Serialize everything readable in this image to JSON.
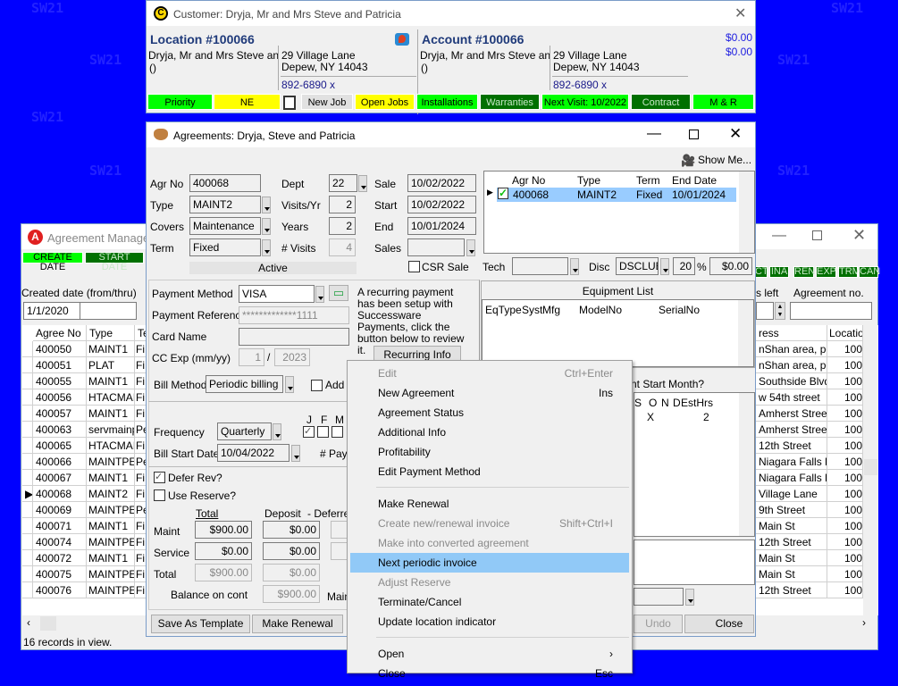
{
  "watermark": "SW21",
  "customer": {
    "title": "Customer: Dryja, Mr and Mrs Steve and Patricia",
    "location": {
      "heading": "Location #100066",
      "name": "Dryja, Mr and Mrs Steve and F",
      "phone_paren": "()",
      "addr1": "29 Village Lane",
      "addr2": "Depew, NY  14043",
      "phone": "892-6890 x"
    },
    "account": {
      "heading": "Account #100066",
      "name": "Dryja, Mr and Mrs Steve and F",
      "phone_paren": "()",
      "addr1": "29 Village Lane",
      "addr2": "Depew, NY  14043",
      "phone": "892-6890 x",
      "balance1": "$0.00",
      "balance2": "$0.00"
    },
    "buttons": [
      "Priority",
      "NE",
      "New Job",
      "Open Jobs",
      "Installations",
      "Warranties",
      "Next Visit: 10/2022",
      "Contract",
      "M & R"
    ]
  },
  "manager": {
    "title": "Agreement Manager",
    "filters_left": [
      "CREATE DATE",
      "START DATE"
    ],
    "filters_right": [
      "CT",
      "INA",
      "REN",
      "EXP",
      "TRM",
      "CAN"
    ],
    "created_label": "Created date (from/thru)",
    "created_from": "1/1/2020",
    "created_thru": "",
    "visits_left_label": "s left",
    "agreement_no_label": "Agreement no.",
    "agreement_no": "",
    "columns": [
      "Agree No",
      "Type",
      "Te"
    ],
    "right_columns": [
      "ress",
      "Location"
    ],
    "rows": [
      [
        "400050",
        "MAINT1",
        "Fi",
        "nShan area, poly",
        "100"
      ],
      [
        "400051",
        "PLAT",
        "Fi",
        "nShan area, poly",
        "100"
      ],
      [
        "400055",
        "MAINT1",
        "Fi",
        "Southside Blvd.",
        "100"
      ],
      [
        "400056",
        "HTACMAIN",
        "Fi",
        "w 54th street",
        "100"
      ],
      [
        "400057",
        "MAINT1",
        "Fi",
        "Amherst Street",
        "100"
      ],
      [
        "400063",
        "servmainpe",
        "Pe",
        "Amherst Street",
        "100"
      ],
      [
        "400065",
        "HTACMAIN",
        "Fi",
        "12th Street",
        "100"
      ],
      [
        "400066",
        "MAINTPER",
        "Pe",
        "Niagara Falls Blv",
        "100"
      ],
      [
        "400067",
        "MAINT1",
        "Fi",
        "Niagara Falls Blv",
        "100"
      ],
      [
        "400068",
        "MAINT2",
        "Fi",
        "Village Lane",
        "100"
      ],
      [
        "400069",
        "MAINTPER",
        "Pe",
        "9th Street",
        "100"
      ],
      [
        "400071",
        "MAINT1",
        "Fi",
        "Main St",
        "100"
      ],
      [
        "400074",
        "MAINTPER",
        "Fi",
        "12th Street",
        "100"
      ],
      [
        "400072",
        "MAINT1",
        "Fi",
        "Main St",
        "100"
      ],
      [
        "400075",
        "MAINTPER",
        "Fi",
        "Main St",
        "100"
      ],
      [
        "400076",
        "MAINTPER",
        "Fi",
        "12th Street",
        "100"
      ]
    ],
    "selected_row": "400068",
    "status": "16 records in view."
  },
  "agreement": {
    "title": "Agreements: Dryja, Steve and Patricia",
    "agr_no_label": "Agr No",
    "agr_no": "400068",
    "type_label": "Type",
    "type": "MAINT2",
    "covers_label": "Covers",
    "covers": "Maintenance",
    "term_label": "Term",
    "term": "Fixed",
    "dept_label": "Dept",
    "dept": "22",
    "visits_yr_label": "Visits/Yr",
    "visits_yr": "2",
    "years_label": "Years",
    "years": "2",
    "num_visits_label": "# Visits",
    "num_visits": "4",
    "sale_label": "Sale",
    "sale": "10/02/2022",
    "start_label": "Start",
    "start": "10/02/2022",
    "end_label": "End",
    "end": "10/01/2024",
    "sales_label": "Sales",
    "sales": "",
    "status": "Active",
    "csr_sale": "CSR Sale",
    "payment_method_label": "Payment Method",
    "payment_method": "VISA",
    "payment_ref_label": "Payment Reference",
    "payment_ref": "*************1111",
    "card_name_label": "Card Name",
    "card_name": "",
    "cc_exp_label": "CC Exp (mm/yy)",
    "cc_month": "1",
    "cc_year": "2023",
    "recurring_note": "A recurring payment has been setup with Successware Payments, click the button below to review it.",
    "recurring_button": "Recurring Info",
    "bill_method_label": "Bill Method",
    "bill_method": "Periodic billing",
    "add_t": "Add T",
    "frequency_label": "Frequency",
    "frequency": "Quarterly",
    "bill_start_label": "Bill Start Date",
    "bill_start": "10/04/2022",
    "months": [
      "J",
      "F",
      "M"
    ],
    "num_pay": "# Payı",
    "defer_rev": "Defer Rev?",
    "use_reserve": "Use Reserve?",
    "total_h": "Total",
    "deposit_h": "Deposit",
    "deferred_h": "- Deferre",
    "maint_label": "Maint",
    "maint_total": "$900.00",
    "maint_deposit": "$0.00",
    "service_label": "Service",
    "service_total": "$0.00",
    "service_deposit": "$0.00",
    "total_label": "Total",
    "total_total": "$900.00",
    "total_deposit": "$0.00",
    "balance_label": "Balance on cont",
    "balance": "$900.00",
    "main_label": "Main",
    "save_template": "Save As Template",
    "make_renewal": "Make Renewal",
    "undo": "Undo",
    "close": "Close",
    "show_me": "Show Me...",
    "list_columns": [
      "Agr No",
      "Type",
      "Term",
      "End Date"
    ],
    "list_row": [
      "400068",
      "MAINT2",
      "Fixed",
      "10/01/2024"
    ],
    "tech_label": "Tech",
    "tech": "",
    "disc_label": "Disc",
    "disc": "DSCLUB",
    "disc_pct": "20",
    "pct": "%",
    "disc_amt": "$0.00",
    "equipment_title": "Equipment List",
    "equipment_columns": [
      "EqType",
      "Syst",
      "Mfg",
      "ModelNo",
      "SerialNo"
    ],
    "start_month_label": "nt Start Month?",
    "month_columns": [
      "S",
      "O",
      "N",
      "D",
      "EstHrs"
    ],
    "month_x": "X",
    "est_hrs": "2"
  },
  "context_menu": [
    {
      "label": "Edit",
      "shortcut": "Ctrl+Enter",
      "disabled": true
    },
    {
      "label": "New Agreement",
      "shortcut": "Ins"
    },
    {
      "label": "Agreement Status"
    },
    {
      "label": "Additional Info"
    },
    {
      "label": "Profitability"
    },
    {
      "label": "Edit Payment Method"
    },
    {
      "sep": true
    },
    {
      "label": "Make Renewal"
    },
    {
      "label": "Create new/renewal invoice",
      "shortcut": "Shift+Ctrl+I",
      "disabled": true
    },
    {
      "label": "Make into converted agreement",
      "disabled": true
    },
    {
      "label": "Next periodic invoice",
      "highlighted": true
    },
    {
      "label": "Adjust Reserve",
      "disabled": true
    },
    {
      "label": "Terminate/Cancel"
    },
    {
      "label": "Update location indicator"
    },
    {
      "sep": true
    },
    {
      "label": "Open",
      "submenu": true
    },
    {
      "label": "Close",
      "shortcut": "Esc"
    }
  ],
  "colors": {
    "desktop": "#0000ff",
    "green": "#00ff00",
    "yellow": "#ffff00",
    "dark_green": "#007000",
    "selection": "#99ccff",
    "menu_highlight": "#91c9f7"
  }
}
